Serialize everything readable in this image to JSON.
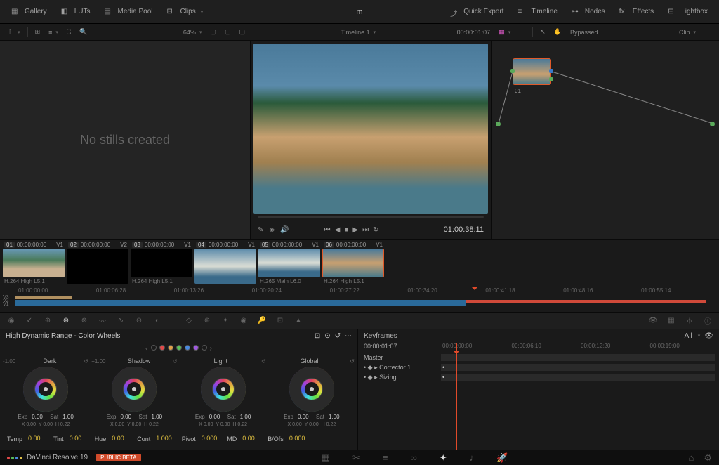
{
  "app": {
    "title": "m"
  },
  "topTabs": {
    "left": [
      {
        "label": "Gallery",
        "icon": "gallery"
      },
      {
        "label": "LUTs",
        "icon": "luts"
      },
      {
        "label": "Media Pool",
        "icon": "mediapool"
      },
      {
        "label": "Clips",
        "icon": "clips",
        "arrow": true
      }
    ],
    "right": [
      {
        "label": "Quick Export",
        "icon": "export"
      },
      {
        "label": "Timeline",
        "icon": "timeline"
      },
      {
        "label": "Nodes",
        "icon": "nodes"
      },
      {
        "label": "Effects",
        "icon": "fx"
      },
      {
        "label": "Lightbox",
        "icon": "lightbox"
      }
    ]
  },
  "toolbar": {
    "zoom": "64%",
    "timeline_label": "Timeline 1",
    "timecode": "00:00:01:07",
    "bypass": "Bypassed",
    "clip_label": "Clip"
  },
  "gallery": {
    "empty": "No stills created"
  },
  "viewer": {
    "timecode": "01:00:38:11"
  },
  "node": {
    "id": "01"
  },
  "thumbs": [
    {
      "num": "01",
      "tc": "00:00:00:00",
      "track": "V1",
      "fmt": "H.264 High L5.1",
      "cls": "beach"
    },
    {
      "num": "02",
      "tc": "00:00:00:00",
      "track": "V2",
      "fmt": "",
      "cls": ""
    },
    {
      "num": "03",
      "tc": "00:00:00:00",
      "track": "V1",
      "fmt": "H.264 High L5.1",
      "cls": ""
    },
    {
      "num": "04",
      "tc": "00:00:00:00",
      "track": "V1",
      "fmt": "",
      "cls": "aerial"
    },
    {
      "num": "05",
      "tc": "00:00:00:00",
      "track": "V1",
      "fmt": "H.265 Main L6.0",
      "cls": "aerial"
    },
    {
      "num": "06",
      "tc": "00:00:00:00",
      "track": "V1",
      "fmt": "H.264 High L5.1",
      "cls": "rocks",
      "active": true
    }
  ],
  "ruler": [
    "01:00:00:00",
    "01:00:06:28",
    "01:00:13:26",
    "01:00:20:24",
    "01:00:27:22",
    "01:00:34:20",
    "01:00:41:18",
    "01:00:48:16",
    "01:00:55:14"
  ],
  "tracks": [
    "V3",
    "V2",
    "V1"
  ],
  "wheelsPanel": {
    "title": "High Dynamic Range - Color Wheels",
    "wheels": [
      {
        "name": "Dark",
        "sub": "-1.00",
        "exp": "0.00",
        "sat": "1.00",
        "x": "0.00",
        "y": "0.00",
        "h": "0.22"
      },
      {
        "name": "Shadow",
        "sub": "+1.00",
        "exp": "0.00",
        "sat": "1.00",
        "x": "0.00",
        "y": "0.00",
        "h": "0.22"
      },
      {
        "name": "Light",
        "sub": "",
        "exp": "0.00",
        "sat": "1.00",
        "x": "0.00",
        "y": "0.00",
        "h": "0.22"
      },
      {
        "name": "Global",
        "sub": "",
        "exp": "0.00",
        "sat": "1.00",
        "x": "0.00",
        "y": "0.00",
        "h": "0.22"
      }
    ],
    "adjust": {
      "temp_label": "Temp",
      "temp": "0.00",
      "tint_label": "Tint",
      "tint": "0.00",
      "hue_label": "Hue",
      "hue": "0.00",
      "cont_label": "Cont",
      "cont": "1.000",
      "pivot_label": "Pivot",
      "pivot": "0.000",
      "md_label": "MD",
      "md": "0.00",
      "bo_label": "B/Ofs",
      "bo": "0.000"
    },
    "labels": {
      "exp": "Exp",
      "sat": "Sat",
      "x": "X",
      "y": "Y",
      "h": "H"
    }
  },
  "keyframes": {
    "title": "Keyframes",
    "tc": "00:00:01:07",
    "all": "All",
    "ruler": [
      "00:00:00:00",
      "00:00:06:10",
      "00:00:12:20",
      "00:00:19:00"
    ],
    "rows": [
      "Master",
      "Corrector 1",
      "Sizing"
    ]
  },
  "footer": {
    "product": "DaVinci Resolve 19",
    "badge": "PUBLIC BETA"
  }
}
